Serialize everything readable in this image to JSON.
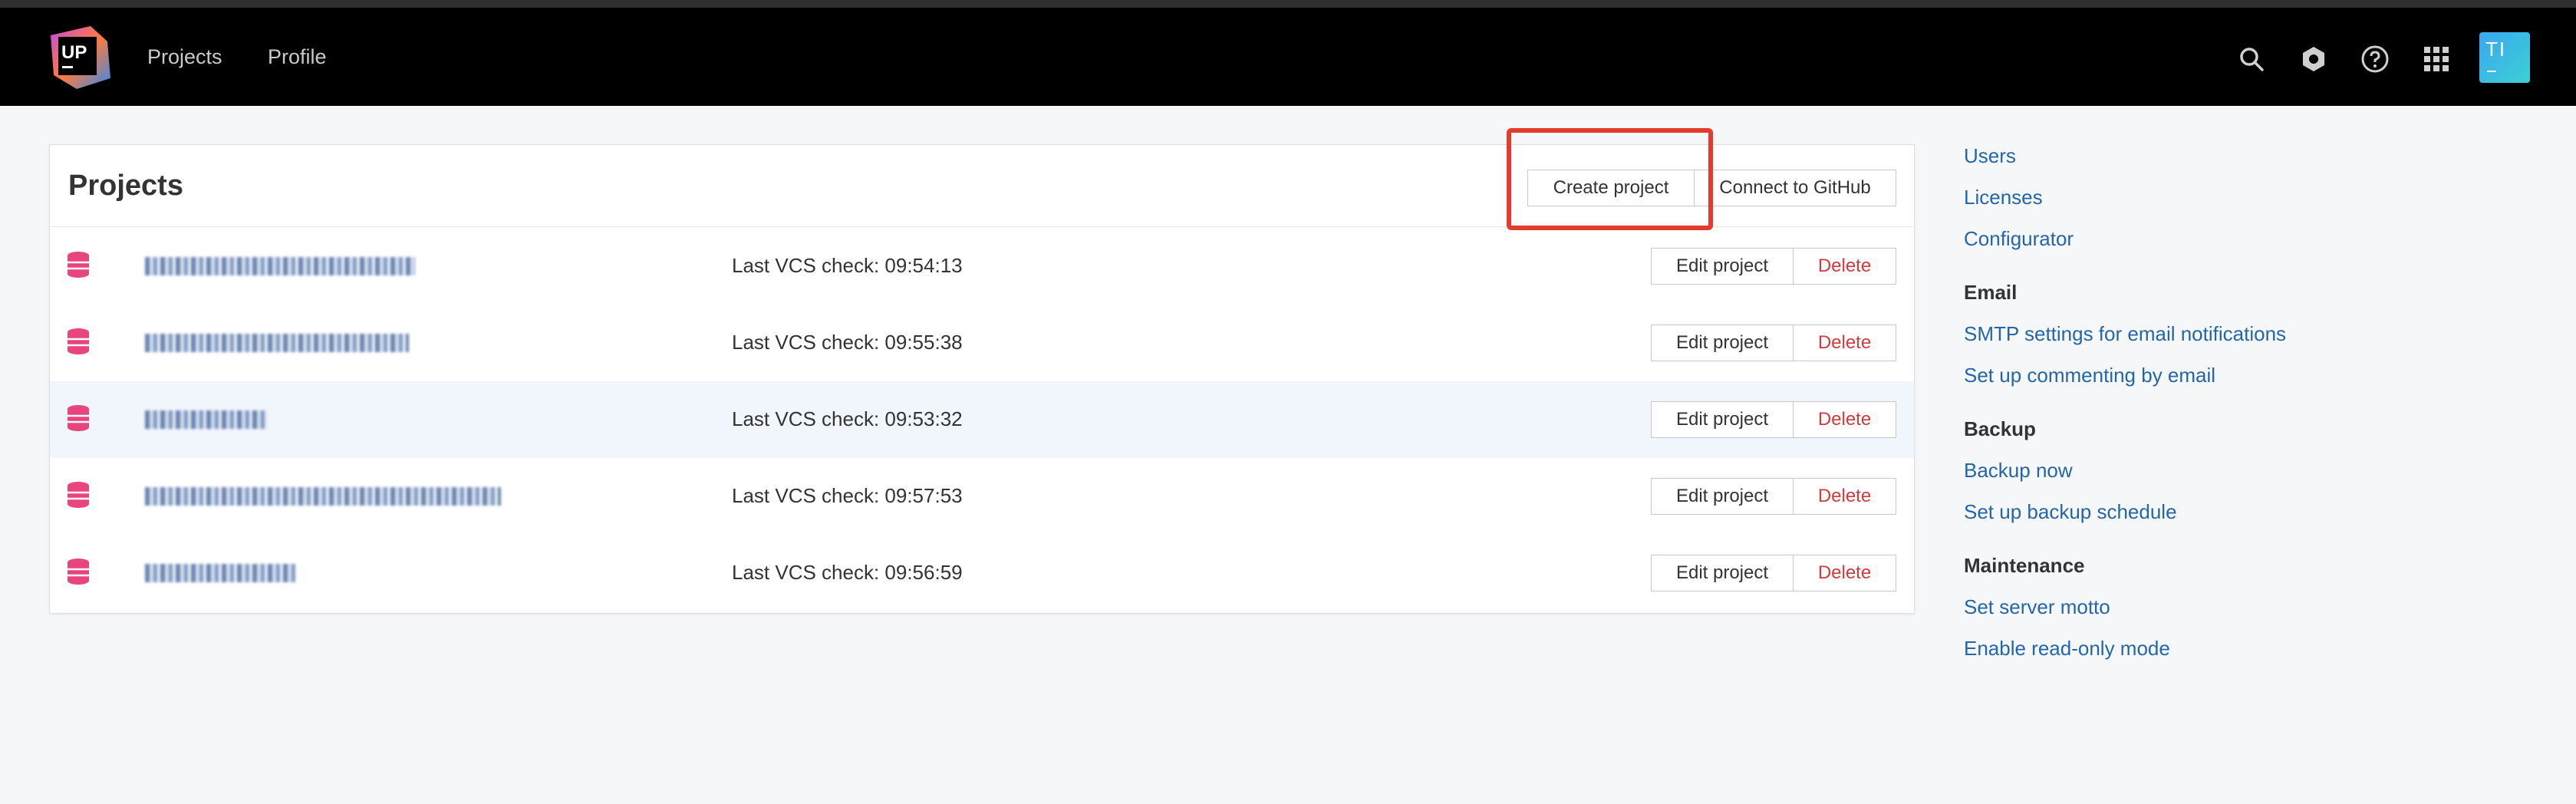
{
  "header": {
    "logo_text": "UP",
    "nav": [
      {
        "label": "Projects"
      },
      {
        "label": "Profile"
      }
    ],
    "icons": [
      "search-icon",
      "settings-icon",
      "help-icon",
      "apps-grid-icon"
    ],
    "avatar_initials": "TI"
  },
  "projects_panel": {
    "title": "Projects",
    "create_label": "Create project",
    "connect_label": "Connect to GitHub",
    "rows": [
      {
        "vcs": "Last VCS check: 09:54:13",
        "edit": "Edit project",
        "delete": "Delete"
      },
      {
        "vcs": "Last VCS check: 09:55:38",
        "edit": "Edit project",
        "delete": "Delete"
      },
      {
        "vcs": "Last VCS check: 09:53:32",
        "edit": "Edit project",
        "delete": "Delete"
      },
      {
        "vcs": "Last VCS check: 09:57:53",
        "edit": "Edit project",
        "delete": "Delete"
      },
      {
        "vcs": "Last VCS check: 09:56:59",
        "edit": "Edit project",
        "delete": "Delete"
      }
    ]
  },
  "sidebar": {
    "links_top": [
      "Users",
      "Licenses",
      "Configurator"
    ],
    "email_heading": "Email",
    "email_links": [
      "SMTP settings for email notifications",
      "Set up commenting by email"
    ],
    "backup_heading": "Backup",
    "backup_links": [
      "Backup now",
      "Set up backup schedule"
    ],
    "maintenance_heading": "Maintenance",
    "maintenance_links": [
      "Set server motto",
      "Enable read-only mode"
    ]
  },
  "colors": {
    "accent_link": "#2466a8",
    "danger": "#d13b3b",
    "highlight_box": "#e53b2c",
    "db_icon": "#e8457e"
  }
}
